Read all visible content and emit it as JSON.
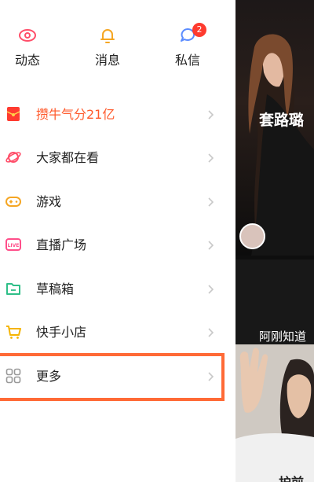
{
  "top_actions": [
    {
      "label": "动态",
      "icon": "eye-icon"
    },
    {
      "label": "消息",
      "icon": "bell-icon"
    },
    {
      "label": "私信",
      "icon": "chat-bubble-icon",
      "badge": "2"
    }
  ],
  "menu": [
    {
      "label": "攒牛气分21亿",
      "icon": "red-envelope-icon"
    },
    {
      "label": "大家都在看",
      "icon": "planet-icon"
    },
    {
      "label": "游戏",
      "icon": "gamepad-icon"
    },
    {
      "label": "直播广场",
      "icon": "live-icon"
    },
    {
      "label": "草稿箱",
      "icon": "folder-icon"
    },
    {
      "label": "快手小店",
      "icon": "shopping-cart-icon"
    },
    {
      "label": "更多",
      "icon": "grid-icon"
    }
  ],
  "feed": {
    "card1_caption": "套路璐",
    "card2_caption": "阿刚知道",
    "card2_bottom": "护前"
  },
  "colors": {
    "accent": "#ff5a2c",
    "badge": "#fe3b2f",
    "highlight_frame": "#ff6a36"
  }
}
